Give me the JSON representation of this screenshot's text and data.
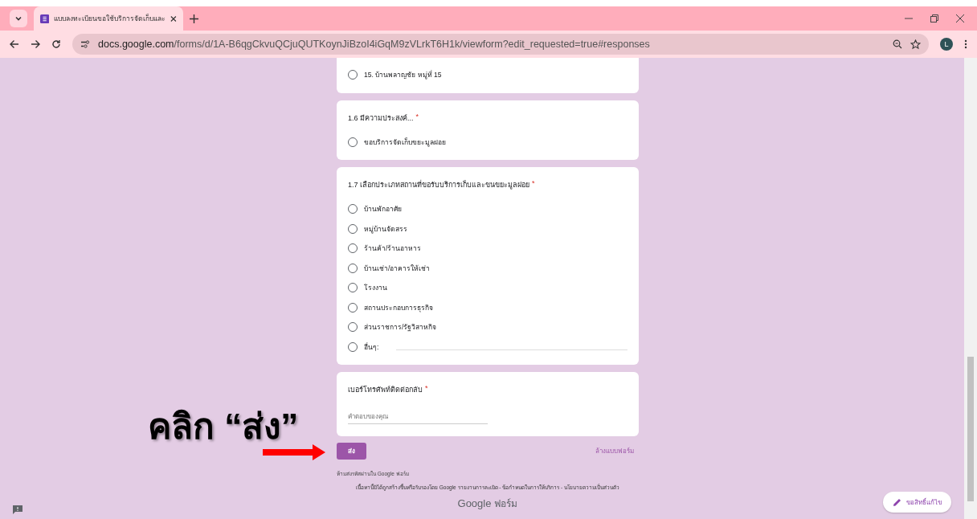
{
  "browser": {
    "tab_title": "แบบลงทะเบียนขอใช้บริการจัดเก็บและ",
    "url_host": "docs.google.com",
    "url_path": "/forms/d/1A-B6qgCkvuQCjuQUTKoynJiBzoI4iGqM9zVLrkT6H1k/viewform?edit_requested=true#responses",
    "avatar": "L"
  },
  "form": {
    "cards": [
      {
        "kind": "choice",
        "cut": true,
        "options": [
          {
            "label": "15. บ้านพลาญชัย หมู่ที่ 15",
            "selected": false,
            "kind": "plain"
          }
        ]
      },
      {
        "kind": "choice",
        "title": "1.6 มีความประสงค์...",
        "required": true,
        "options": [
          {
            "label": "ขอบริการจัดเก็บขยะมูลฝอย",
            "selected": false,
            "kind": "plain"
          }
        ]
      },
      {
        "kind": "choice",
        "title": "1.7 เลือกประเภทสถานที่ขอรับบริการเก็บและขนขยะมูลฝอย",
        "required": true,
        "options": [
          {
            "label": "บ้านพักอาศัย",
            "selected": false,
            "kind": "plain"
          },
          {
            "label": "หมู่บ้านจัดสรร",
            "selected": false,
            "kind": "plain"
          },
          {
            "label": "ร้านค้า/ร้านอาหาร",
            "selected": false,
            "kind": "plain"
          },
          {
            "label": "บ้านเช่า/อาคารให้เช่า",
            "selected": false,
            "kind": "plain"
          },
          {
            "label": "โรงงาน",
            "selected": false,
            "kind": "plain"
          },
          {
            "label": "สถานประกอบการธุรกิจ",
            "selected": false,
            "kind": "plain"
          },
          {
            "label": "ส่วนราชการ/รัฐวิสาหกิจ",
            "selected": false,
            "kind": "plain"
          },
          {
            "label": "อื่นๆ:",
            "selected": false,
            "kind": "other"
          }
        ]
      },
      {
        "kind": "text",
        "title": "เบอร์โทรศัพท์ติดต่อกลับ",
        "required": true,
        "placeholder": "คำตอบของคุณ"
      }
    ],
    "submit": "ส่ง",
    "clear": "ล้างแบบฟอร์ม",
    "note": "ห้ามส่งรหัสผ่านใน Google ฟอร์ม",
    "disclaimer": "เนื้อหานี้มิได้ถูกสร้างขึ้นหรือรับรองโดย Google",
    "required_mark": "*",
    "link_separator": "-",
    "links": [
      "รายงานการละเมิด",
      "ข้อกำหนดในการให้บริการ",
      "นโยบายความเป็นส่วนตัว"
    ],
    "brand_google": "Google",
    "brand_forms": "ฟอร์ม",
    "edit_button": "ขอสิทธิ์แก้ไข"
  },
  "annotation": {
    "text": "คลิก “ส่ง”"
  }
}
